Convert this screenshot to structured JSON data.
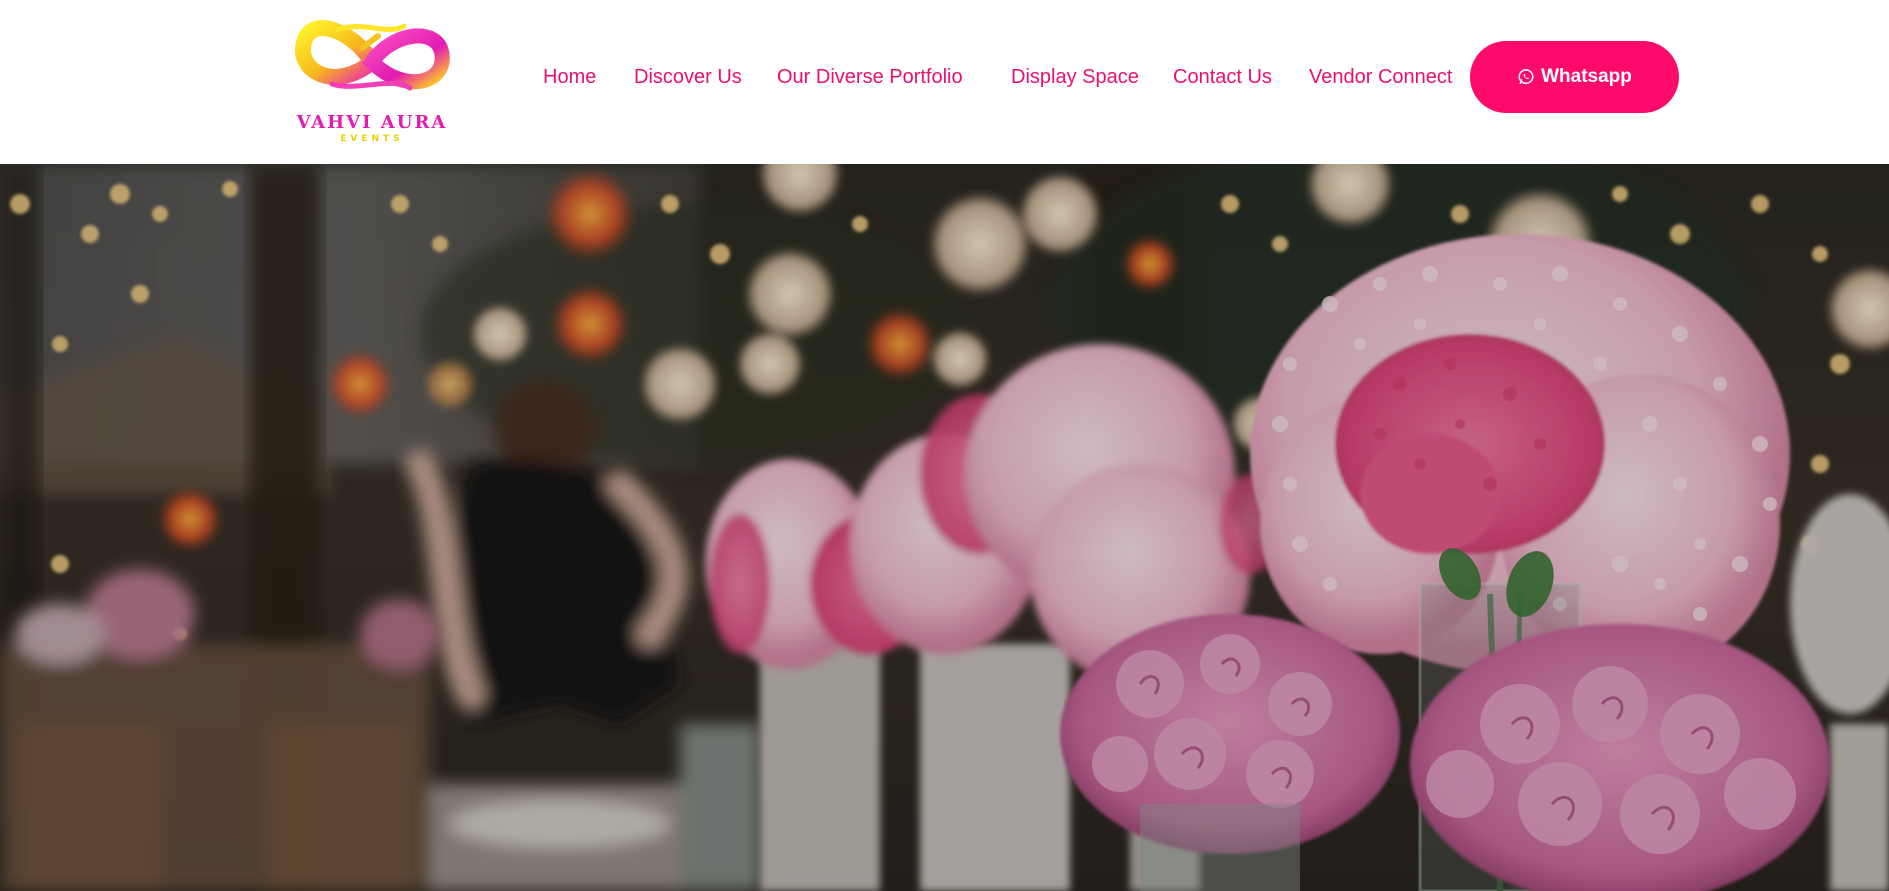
{
  "brand": {
    "name": "VAHVI AURA",
    "tagline": "EVENTS",
    "logo_icon": "infinity-swirl-logo",
    "colors": {
      "magenta": "#e41db2",
      "yellow": "#f4e21a",
      "pink_accent": "#ea0f73"
    }
  },
  "nav": {
    "items": [
      {
        "label": "Home"
      },
      {
        "label": "Discover Us"
      },
      {
        "label": "Our Diverse Portfolio"
      },
      {
        "label": "Display Space"
      },
      {
        "label": "Contact Us"
      },
      {
        "label": "Vendor Connect"
      }
    ]
  },
  "cta": {
    "label": "Whatsapp",
    "icon": "whatsapp-icon",
    "color": "#fc0a6c"
  },
  "hero": {
    "image": "blurred-floral-event-decor-photo",
    "overlay_color": "#000000"
  }
}
